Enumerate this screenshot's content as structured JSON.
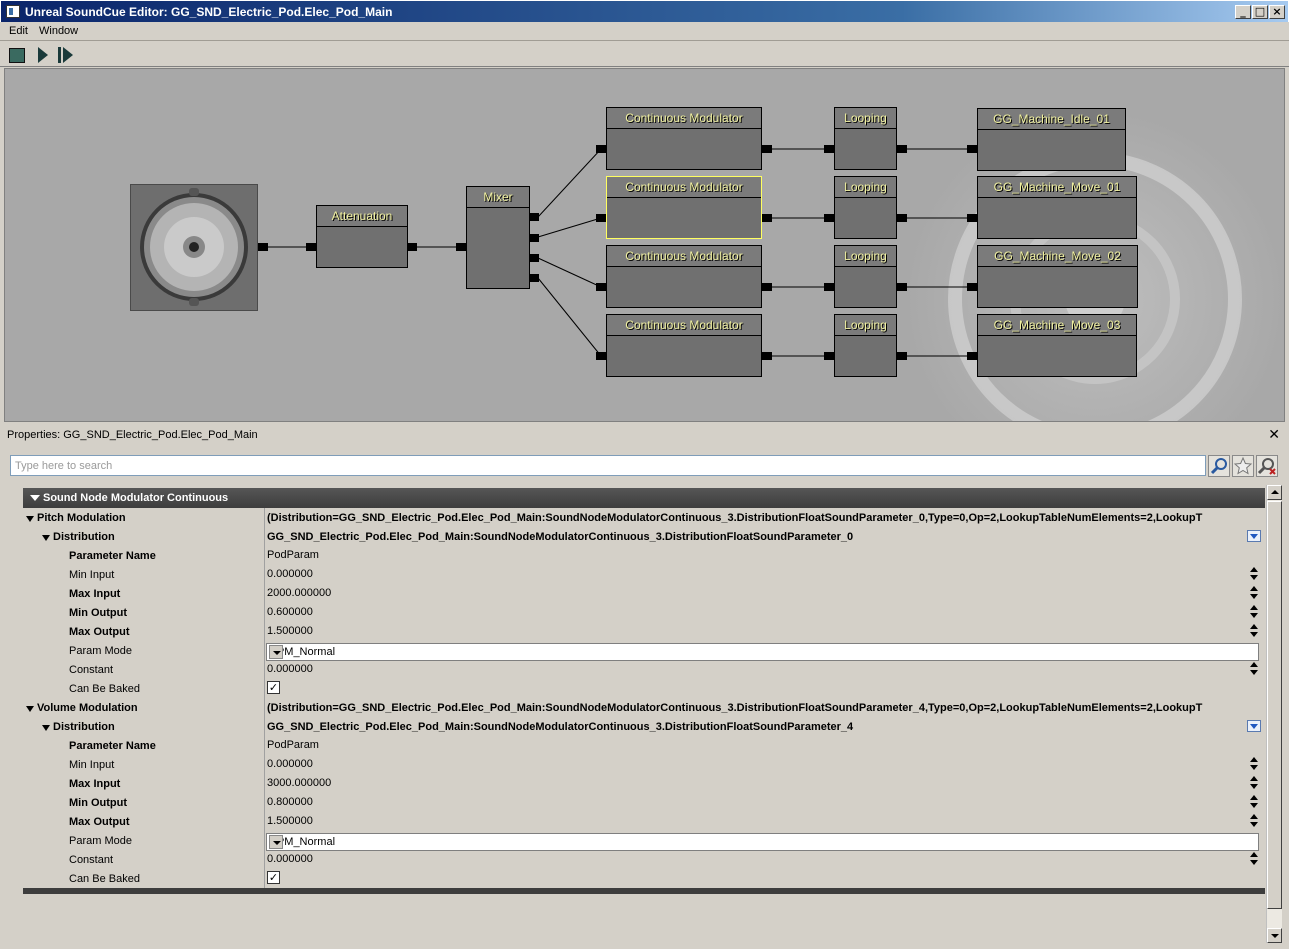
{
  "window": {
    "title": "Unreal SoundCue Editor: GG_SND_Electric_Pod.Elec_Pod_Main"
  },
  "menu": {
    "items": [
      "Edit",
      "Window"
    ]
  },
  "graph": {
    "nodes": {
      "attenuation": "Attenuation",
      "mixer": "Mixer",
      "modulator_1": "Continuous Modulator",
      "modulator_2": "Continuous Modulator",
      "modulator_3": "Continuous Modulator",
      "modulator_4": "Continuous Modulator",
      "looping_1": "Looping",
      "looping_2": "Looping",
      "looping_3": "Looping",
      "looping_4": "Looping",
      "wave_1": "GG_Machine_Idle_01",
      "wave_2": "GG_Machine_Move_01",
      "wave_3": "GG_Machine_Move_02",
      "wave_4": "GG_Machine_Move_03"
    }
  },
  "properties": {
    "title": "Properties: GG_SND_Electric_Pod.Elec_Pod_Main",
    "search_placeholder": "Type here to search",
    "category": "Sound Node Modulator Continuous",
    "pitch": {
      "label": "Pitch Modulation",
      "value": "(Distribution=GG_SND_Electric_Pod.Elec_Pod_Main:SoundNodeModulatorContinuous_3.DistributionFloatSoundParameter_0,Type=0,Op=2,LookupTableNumElements=2,LookupT",
      "distribution_label": "Distribution",
      "distribution_value": "GG_SND_Electric_Pod.Elec_Pod_Main:SoundNodeModulatorContinuous_3.DistributionFloatSoundParameter_0",
      "param_name_label": "Parameter Name",
      "param_name": "PodParam",
      "min_input_label": "Min Input",
      "min_input": "0.000000",
      "max_input_label": "Max Input",
      "max_input": "2000.000000",
      "min_output_label": "Min Output",
      "min_output": "0.600000",
      "max_output_label": "Max Output",
      "max_output": "1.500000",
      "param_mode_label": "Param Mode",
      "param_mode": "DPM_Normal",
      "constant_label": "Constant",
      "constant": "0.000000",
      "baked_label": "Can Be Baked",
      "baked": "✓"
    },
    "volume": {
      "label": "Volume Modulation",
      "value": "(Distribution=GG_SND_Electric_Pod.Elec_Pod_Main:SoundNodeModulatorContinuous_3.DistributionFloatSoundParameter_4,Type=0,Op=2,LookupTableNumElements=2,LookupT",
      "distribution_label": "Distribution",
      "distribution_value": "GG_SND_Electric_Pod.Elec_Pod_Main:SoundNodeModulatorContinuous_3.DistributionFloatSoundParameter_4",
      "param_name_label": "Parameter Name",
      "param_name": "PodParam",
      "min_input_label": "Min Input",
      "min_input": "0.000000",
      "max_input_label": "Max Input",
      "max_input": "3000.000000",
      "min_output_label": "Min Output",
      "min_output": "0.800000",
      "max_output_label": "Max Output",
      "max_output": "1.500000",
      "param_mode_label": "Param Mode",
      "param_mode": "DPM_Normal",
      "constant_label": "Constant",
      "constant": "0.000000",
      "baked_label": "Can Be Baked",
      "baked": "✓"
    }
  }
}
